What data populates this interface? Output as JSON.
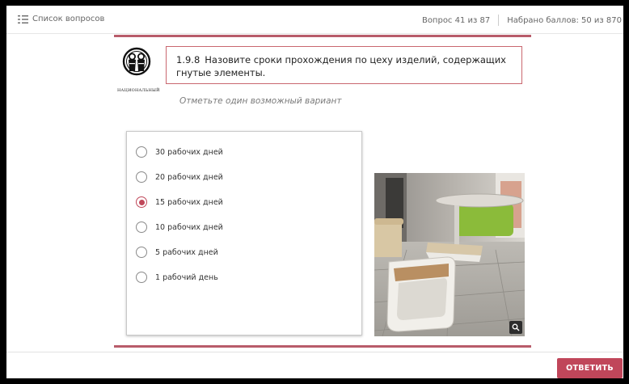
{
  "header": {
    "question_list_label": "Список вопросов",
    "question_counter": "Вопрос 41 из 87",
    "score": "Набрано баллов: 50 из 870"
  },
  "logo": {
    "caption": "НАЦИОНАЛЬНЫЙ"
  },
  "question": {
    "number": "1.9.8",
    "text": "Назовите сроки прохождения по цеху изделий, содержащих гнутые элементы.",
    "hint": "Отметьте один возможный вариант"
  },
  "options": [
    {
      "label": "30 рабочих дней",
      "checked": false
    },
    {
      "label": "20 рабочих дней",
      "checked": false
    },
    {
      "label": "15 рабочих дней",
      "checked": true
    },
    {
      "label": "10 рабочих дней",
      "checked": false
    },
    {
      "label": "5 рабочих дней",
      "checked": false
    },
    {
      "label": "1 рабочий день",
      "checked": false
    }
  ],
  "icons": {
    "question_list": "list-icon",
    "zoom": "magnifier-icon"
  },
  "colors": {
    "accent": "#c0465a",
    "accent_line": "#b85c6a"
  },
  "actions": {
    "answer_label": "ОТВЕТИТЬ"
  }
}
